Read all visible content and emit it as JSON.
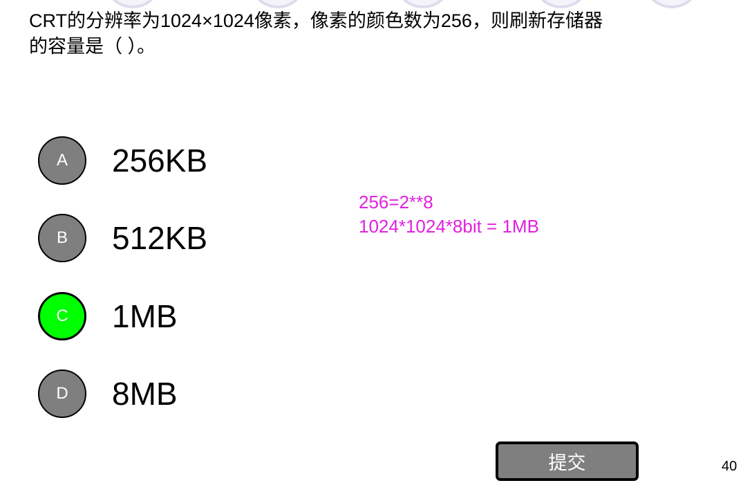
{
  "question": {
    "line1": "CRT的分辨率为1024×1024像素，像素的颜色数为256，则刷新存储器",
    "line2": "的容量是（      ）。"
  },
  "options": [
    {
      "letter": "A",
      "text": "256KB",
      "selected": false
    },
    {
      "letter": "B",
      "text": "512KB",
      "selected": false
    },
    {
      "letter": "C",
      "text": "1MB",
      "selected": true
    },
    {
      "letter": "D",
      "text": "8MB",
      "selected": false
    }
  ],
  "note": {
    "line1": "256=2**8",
    "line2": "1024*1024*8bit = 1MB"
  },
  "submit": {
    "label": "提交"
  },
  "page_number": "40",
  "colors": {
    "option_default": "#7f7f7f",
    "option_selected": "#00ff00",
    "note_text": "#e020e0",
    "submit_bg": "#7f7f7f"
  }
}
